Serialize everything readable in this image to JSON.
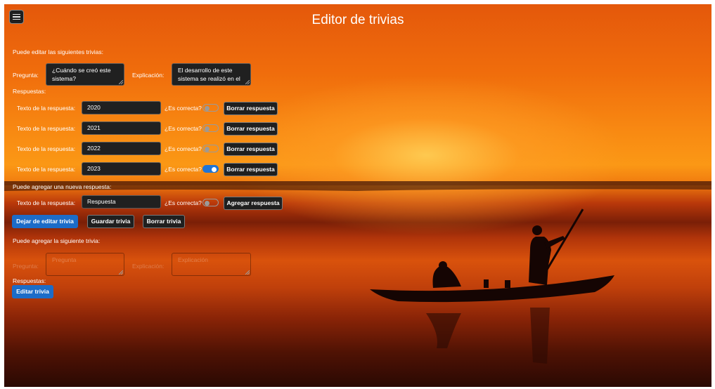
{
  "header": {
    "title": "Editor de trivias",
    "menu_icon": "hamburger-icon"
  },
  "edit": {
    "intro": "Puede editar las siguientes trivias:",
    "question_label": "Pregunta:",
    "question_value": "¿Cuándo se creó este sistema?",
    "explanation_label": "Explicación:",
    "explanation_value": "El desarrollo de este sistema se realizó en el",
    "answers_label": "Respuestas:",
    "answers": [
      {
        "label": "Texto de la respuesta:",
        "value": "2020",
        "correct_label": "¿Es correcta?",
        "correct": false,
        "delete_label": "Borrar respuesta"
      },
      {
        "label": "Texto de la respuesta:",
        "value": "2021",
        "correct_label": "¿Es correcta?",
        "correct": false,
        "delete_label": "Borrar respuesta"
      },
      {
        "label": "Texto de la respuesta:",
        "value": "2022",
        "correct_label": "¿Es correcta?",
        "correct": false,
        "delete_label": "Borrar respuesta"
      },
      {
        "label": "Texto de la respuesta:",
        "value": "2023",
        "correct_label": "¿Es correcta?",
        "correct": true,
        "delete_label": "Borrar respuesta"
      }
    ],
    "new_answer_intro": "Puede agregar una nueva respuesta:",
    "new_answer": {
      "label": "Texto de la respuesta:",
      "placeholder": "Respuesta",
      "correct_label": "¿Es correcta?",
      "correct": false,
      "add_label": "Agregar respuesta"
    },
    "stop_editing_label": "Dejar de editar trivia",
    "save_label": "Guardar trivia",
    "delete_label": "Borrar trivia"
  },
  "add": {
    "intro": "Puede agregar la siguiente trivia:",
    "question_label": "Pregunta:",
    "question_placeholder": "Pregunta",
    "explanation_label": "Explicación:",
    "explanation_placeholder": "Explicación",
    "answers_label": "Respuestas:",
    "edit_label": "Editar trivia"
  },
  "colors": {
    "primary_button": "#1c6cc8",
    "toggle_on": "#1e74d6",
    "dark_control": "#202020"
  }
}
